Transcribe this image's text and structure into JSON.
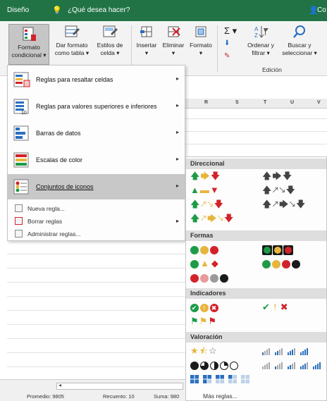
{
  "titlebar": {
    "tab": "Diseño",
    "search": "¿Qué desea hacer?",
    "user": "Co"
  },
  "ribbon": {
    "buttons": [
      {
        "label1": "Formato",
        "label2": "condicional ▾"
      },
      {
        "label1": "Dar formato",
        "label2": "como tabla ▾"
      },
      {
        "label1": "Estilos de",
        "label2": "celda ▾"
      },
      {
        "label1": "Insertar",
        "label2": "▾"
      },
      {
        "label1": "Eliminar",
        "label2": "▾"
      },
      {
        "label1": "Formato",
        "label2": "▾"
      },
      {
        "label1": "Ordenar y",
        "label2": "filtrar ▾"
      },
      {
        "label1": "Buscar y",
        "label2": "seleccionar ▾"
      }
    ],
    "edicion_label": "Edición",
    "sigma": "Σ ▾",
    "fill": "▾"
  },
  "columns": [
    "R",
    "S",
    "T",
    "U",
    "V"
  ],
  "menu": {
    "items": [
      {
        "label": "Reglas para resaltar celdas",
        "icon": "highlight-cells-rules-icon"
      },
      {
        "label": "Reglas para valores superiores e inferiores",
        "icon": "top-bottom-rules-icon"
      },
      {
        "label": "Barras de datos",
        "icon": "data-bars-icon"
      },
      {
        "label": "Escalas de color",
        "icon": "color-scales-icon"
      },
      {
        "label": "Conjuntos de iconos",
        "icon": "icon-sets-icon"
      }
    ],
    "small_items": [
      {
        "label": "Nueva regla..."
      },
      {
        "label": "Borrar reglas"
      },
      {
        "label": "Administrar reglas..."
      }
    ],
    "arrow": "▸"
  },
  "submenu": {
    "sections": {
      "direccional": "Direccional",
      "formas": "Formas",
      "indicadores": "Indicadores",
      "valoracion": "Valoración"
    },
    "more": "Más reglas..."
  },
  "status": {
    "promedio": "Promedio: 9805",
    "recuento": "Recuento: 10",
    "suma": "Suma: 980"
  },
  "colors": {
    "green": "#1e9b48",
    "yellow": "#e8b53c",
    "red": "#d2232a",
    "black": "#1a1a1a",
    "gray": "#9a9a9a",
    "excel_green": "#217346",
    "blue": "#2a6fc0"
  }
}
